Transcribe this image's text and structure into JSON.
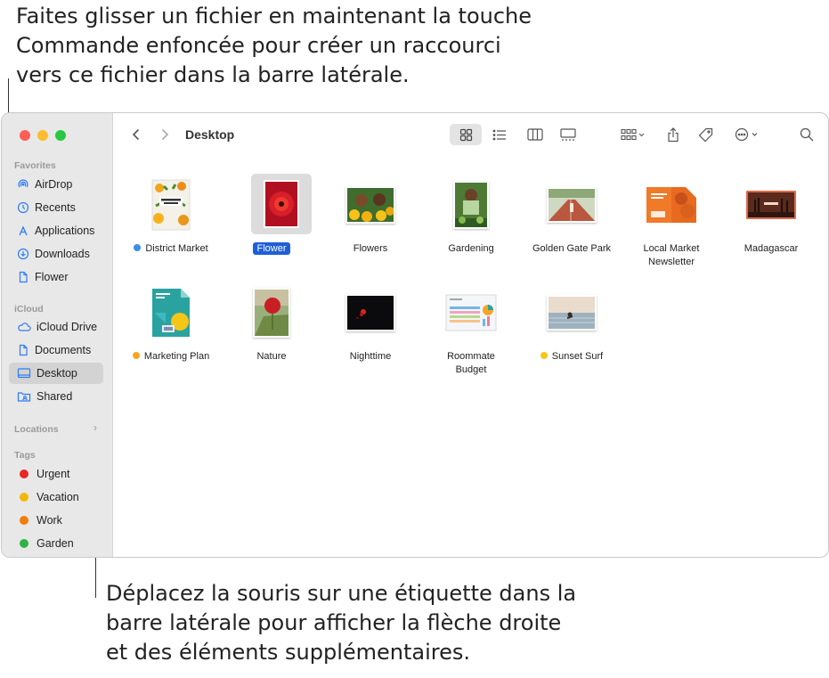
{
  "callouts": {
    "top": "Faites glisser un fichier en maintenant la touche\nCommande enfoncée pour créer un raccourci\nvers ce fichier dans la barre latérale.",
    "bottom": "Déplacez la souris sur une étiquette dans la\nbarre latérale pour afficher la flèche droite\net des éléments supplémentaires."
  },
  "window": {
    "title": "Desktop"
  },
  "sidebar": {
    "favorites_title": "Favorites",
    "favorites": [
      "AirDrop",
      "Recents",
      "Applications",
      "Downloads",
      "Flower"
    ],
    "icloud_title": "iCloud",
    "icloud": [
      "iCloud Drive",
      "Documents",
      "Desktop",
      "Shared"
    ],
    "locations_title": "Locations",
    "tags_title": "Tags",
    "tags": [
      {
        "label": "Urgent",
        "color": "#e8262a"
      },
      {
        "label": "Vacation",
        "color": "#f2b705"
      },
      {
        "label": "Work",
        "color": "#f07d0c"
      },
      {
        "label": "Garden",
        "color": "#2fb344"
      }
    ]
  },
  "files": [
    {
      "name": "District Market",
      "tag_color": "#3a8ee6"
    },
    {
      "name": "Flower",
      "selected": true
    },
    {
      "name": "Flowers"
    },
    {
      "name": "Gardening"
    },
    {
      "name": "Golden Gate Park"
    },
    {
      "name": "Local Market\nNewsletter"
    },
    {
      "name": "Madagascar"
    },
    {
      "name": "Marketing Plan",
      "tag_color": "#f5a623"
    },
    {
      "name": "Nature"
    },
    {
      "name": "Nighttime"
    },
    {
      "name": "Roommate\nBudget"
    },
    {
      "name": "Sunset Surf",
      "tag_color": "#f5c518"
    }
  ],
  "colors": {
    "accent": "#1f5fd6",
    "close": "#fe5f57",
    "minimize": "#febc2e",
    "zoom": "#28c840"
  }
}
